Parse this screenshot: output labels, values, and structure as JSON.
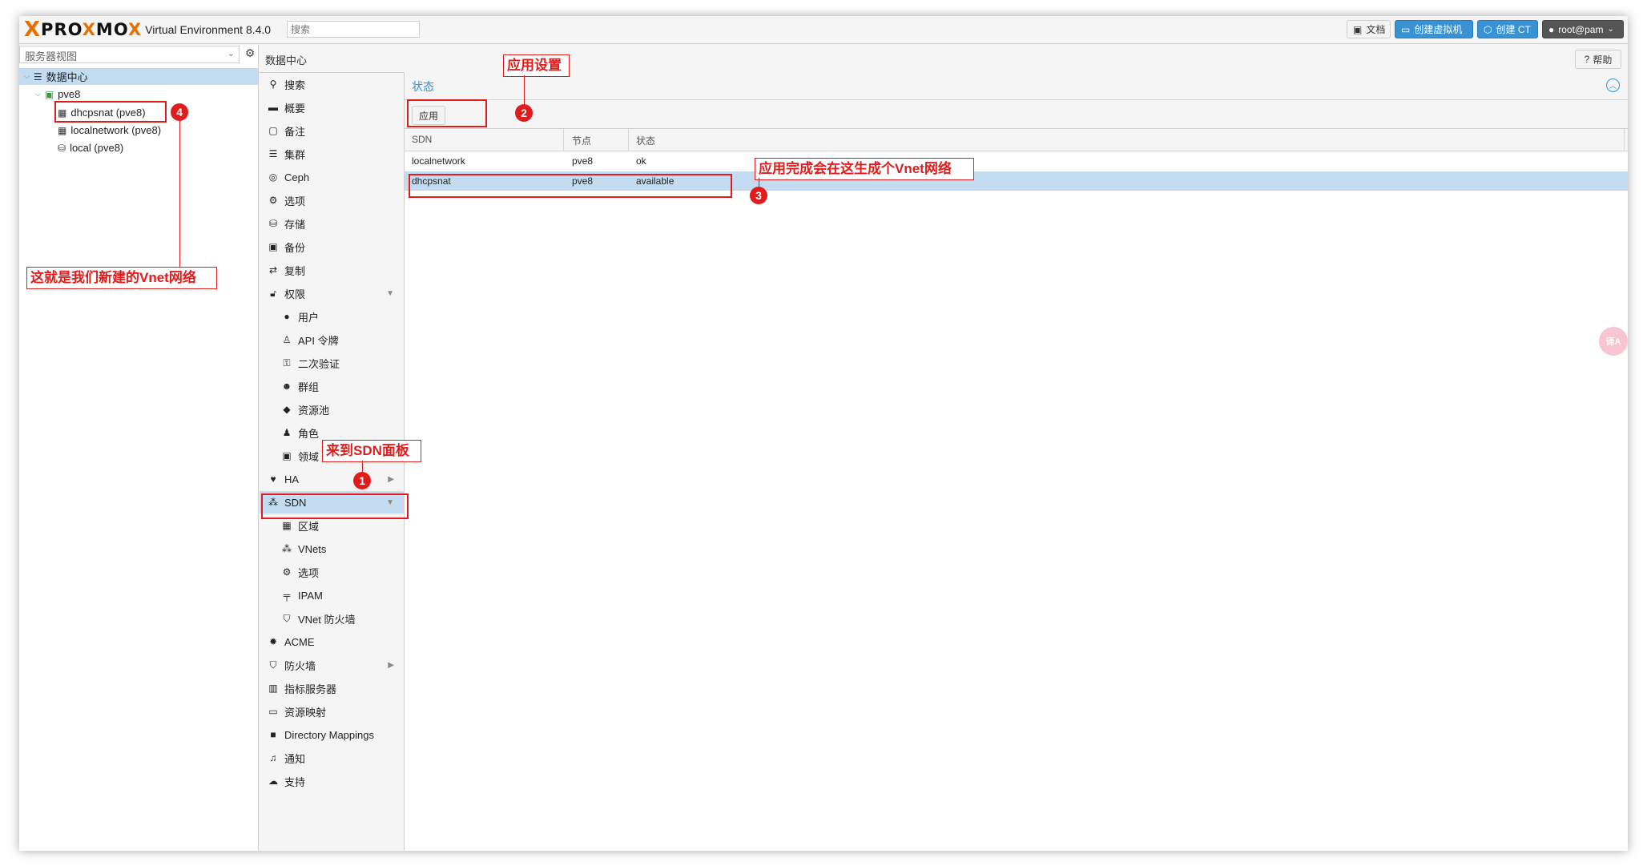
{
  "app": {
    "logo_x": "X",
    "logo_brand_a": "PRO",
    "logo_brand_b": "X",
    "logo_brand_c": "MO",
    "logo_brand_d": "X",
    "version": "Virtual Environment 8.4.0",
    "search_placeholder": "搜索"
  },
  "topbar": {
    "docs": "文档",
    "create_vm": "创建虚拟机",
    "create_ct": "创建 CT",
    "user": "root@pam"
  },
  "tree": {
    "view_label": "服务器视图",
    "datacenter": "数据中心",
    "node": "pve8",
    "items": [
      "dhcpsnat (pve8)",
      "localnetwork (pve8)",
      "local (pve8)"
    ]
  },
  "breadcrumb": "数据中心",
  "help": "帮助",
  "nav": {
    "items": [
      "搜索",
      "概要",
      "备注",
      "集群",
      "Ceph",
      "选项",
      "存储",
      "备份",
      "复制",
      "权限",
      "用户",
      "API 令牌",
      "二次验证",
      "群组",
      "资源池",
      "角色",
      "领域",
      "HA",
      "SDN",
      "区域",
      "VNets",
      "选项",
      "IPAM",
      "VNet 防火墙",
      "ACME",
      "防火墙",
      "指标服务器",
      "资源映射",
      "Directory Mappings",
      "通知",
      "支持"
    ]
  },
  "content": {
    "title": "状态",
    "apply_button": "应用",
    "columns": [
      "SDN",
      "节点",
      "状态"
    ],
    "rows": [
      {
        "sdn": "localnetwork",
        "node": "pve8",
        "status": "ok"
      },
      {
        "sdn": "dhcpsnat",
        "node": "pve8",
        "status": "available"
      }
    ]
  },
  "annotations": {
    "c1": "来到SDN面板",
    "c2": "应用设置",
    "c3": "应用完成会在这生成个Vnet网络",
    "c4": "这就是我们新建的Vnet网络",
    "n1": "1",
    "n2": "2",
    "n3": "3",
    "n4": "4"
  },
  "float_badge": "译A",
  "colors": {
    "accent": "#3892d4",
    "brand": "#e57000",
    "annotation": "#e21c1c",
    "selection": "#c3dcf2"
  }
}
